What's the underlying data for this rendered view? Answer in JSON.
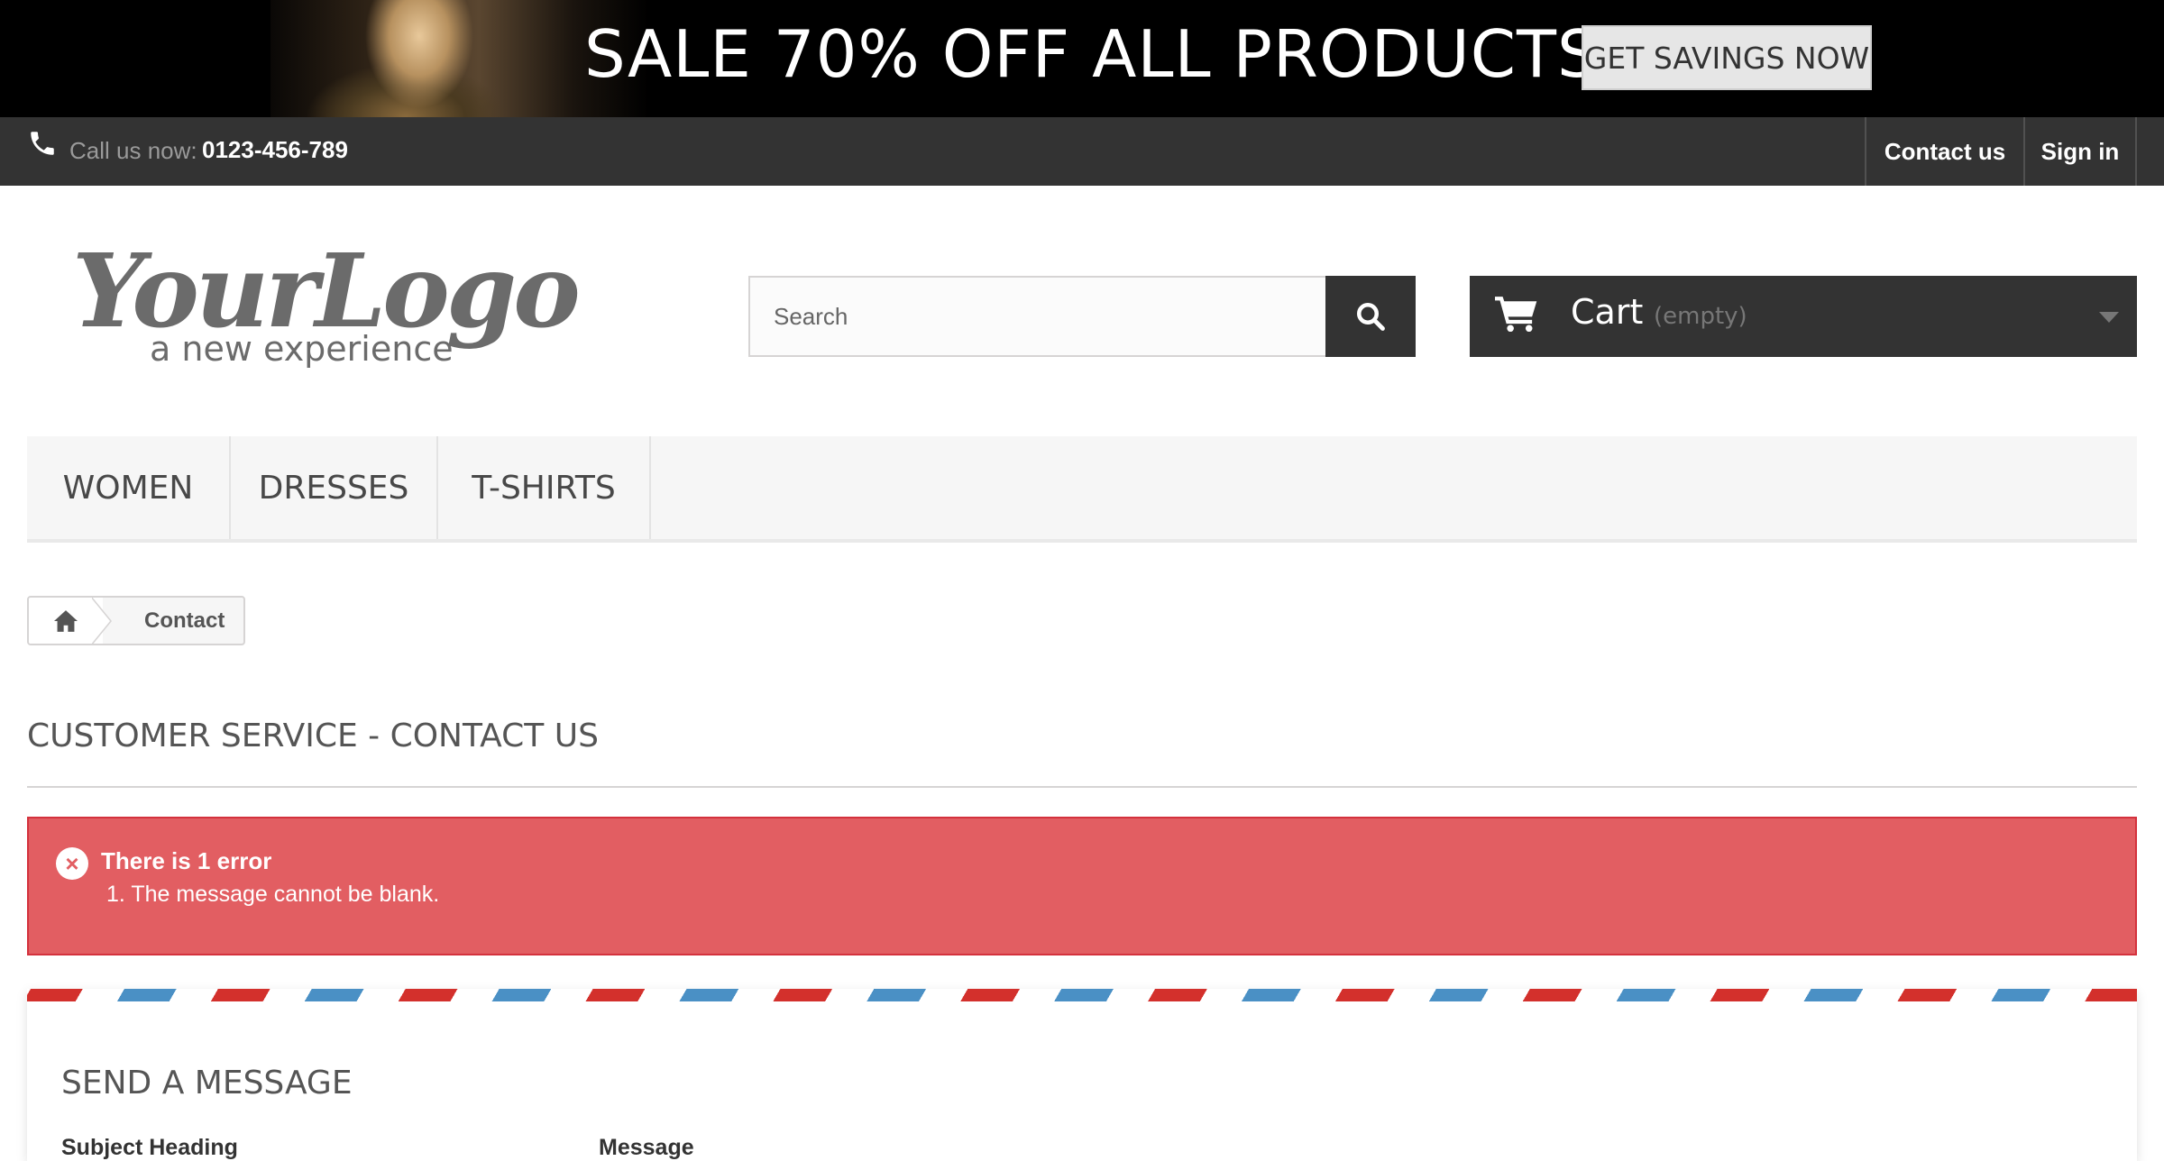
{
  "banner": {
    "headline": "SALE 70% OFF ALL PRODUCTS",
    "cta_label": "GET SAVINGS NOW"
  },
  "topbar": {
    "call_label": "Call us now:",
    "phone_number": "0123-456-789",
    "contact_label": "Contact us",
    "signin_label": "Sign in"
  },
  "header": {
    "logo_text": "YourLogo",
    "logo_tagline": "a new experience",
    "search_placeholder": "Search",
    "cart_label": "Cart",
    "cart_status": "(empty)"
  },
  "menu": {
    "items": [
      {
        "label": "WOMEN"
      },
      {
        "label": "DRESSES"
      },
      {
        "label": "T-SHIRTS"
      }
    ]
  },
  "breadcrumb": {
    "current": "Contact"
  },
  "page": {
    "title": "CUSTOMER SERVICE - CONTACT US"
  },
  "error": {
    "title": "There is 1 error",
    "items": [
      "1. The message cannot be blank."
    ]
  },
  "form": {
    "title": "SEND A MESSAGE",
    "subject_label": "Subject Heading",
    "message_label": "Message"
  },
  "colors": {
    "dark_bar": "#333333",
    "error_bg": "#e25e62",
    "airmail_red": "#d3302c",
    "airmail_blue": "#4a90c5"
  },
  "icons": {
    "phone": "phone-icon",
    "search": "search-icon",
    "cart": "cart-icon",
    "home": "home-icon",
    "error": "error-icon"
  }
}
